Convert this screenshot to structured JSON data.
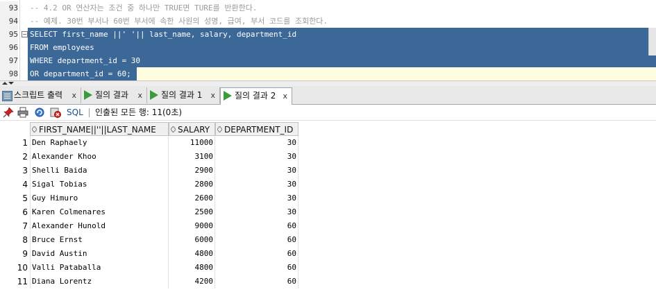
{
  "editor": {
    "lines": [
      {
        "num": "93",
        "text": "-- 4.2 OR 연산자는 조건 중 하나만 TRUE면 TURE를 반환한다."
      },
      {
        "num": "94",
        "text": "-- 예제. 30번 부서나 60번 부서에 속한 사원의 성명, 급여, 부서 코드를 조회한다."
      },
      {
        "num": "95",
        "text": "SELECT first_name ||' '|| last_name, salary, department_id"
      },
      {
        "num": "96",
        "text": "FROM employees"
      },
      {
        "num": "97",
        "text": "WHERE department_id = 30"
      },
      {
        "num": "98",
        "text": "OR department_id = 60;"
      }
    ]
  },
  "tabs": [
    {
      "label": "스크립트 출력",
      "icon": "script-output-icon",
      "close": "x"
    },
    {
      "label": "질의 결과",
      "icon": "run-icon",
      "close": "x"
    },
    {
      "label": "질의 결과 1",
      "icon": "run-icon",
      "close": "x"
    },
    {
      "label": "질의 결과 2",
      "icon": "run-icon",
      "close": "x",
      "active": true
    }
  ],
  "toolbar": {
    "sql_label": "SQL",
    "status": "인출된 모든 행: 11(0초)"
  },
  "grid": {
    "columns": [
      "FIRST_NAME||''||LAST_NAME",
      "SALARY",
      "DEPARTMENT_ID"
    ],
    "rows": [
      {
        "n": "1",
        "name": "Den Raphaely",
        "salary": "11000",
        "dept": "30"
      },
      {
        "n": "2",
        "name": "Alexander Khoo",
        "salary": "3100",
        "dept": "30"
      },
      {
        "n": "3",
        "name": "Shelli Baida",
        "salary": "2900",
        "dept": "30"
      },
      {
        "n": "4",
        "name": "Sigal Tobias",
        "salary": "2800",
        "dept": "30"
      },
      {
        "n": "5",
        "name": "Guy Himuro",
        "salary": "2600",
        "dept": "30"
      },
      {
        "n": "6",
        "name": "Karen Colmenares",
        "salary": "2500",
        "dept": "30"
      },
      {
        "n": "7",
        "name": "Alexander Hunold",
        "salary": "9000",
        "dept": "60"
      },
      {
        "n": "8",
        "name": "Bruce Ernst",
        "salary": "6000",
        "dept": "60"
      },
      {
        "n": "9",
        "name": "David Austin",
        "salary": "4800",
        "dept": "60"
      },
      {
        "n": "10",
        "name": "Valli Pataballa",
        "salary": "4800",
        "dept": "60"
      },
      {
        "n": "11",
        "name": "Diana Lorentz",
        "salary": "4200",
        "dept": "60"
      }
    ]
  },
  "colors": {
    "selection": "#3c6897",
    "comment": "#9a9a9a",
    "run_green": "#3a9b3a",
    "sql_blue": "#1b4d94"
  }
}
